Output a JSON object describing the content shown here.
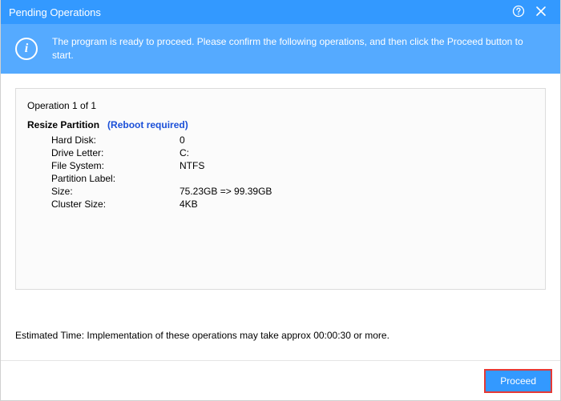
{
  "window": {
    "title": "Pending Operations"
  },
  "banner": {
    "message": "The program is ready to proceed. Please confirm the following operations, and then click the Proceed button to start."
  },
  "operations": {
    "count_text": "Operation 1 of 1",
    "op": {
      "title": "Resize Partition",
      "reboot_text": "Reboot required",
      "rows": {
        "hard_disk": {
          "label": "Hard Disk:",
          "value": "0"
        },
        "drive_letter": {
          "label": "Drive Letter:",
          "value": "C:"
        },
        "file_system": {
          "label": "File System:",
          "value": "NTFS"
        },
        "partition_label": {
          "label": "Partition Label:",
          "value": ""
        },
        "size": {
          "label": "Size:",
          "value": "75.23GB => 99.39GB"
        },
        "cluster_size": {
          "label": "Cluster Size:",
          "value": "4KB"
        }
      }
    }
  },
  "estimate": {
    "text": "Estimated Time: Implementation of these operations may take approx 00:00:30 or more."
  },
  "footer": {
    "proceed_label": "Proceed"
  }
}
